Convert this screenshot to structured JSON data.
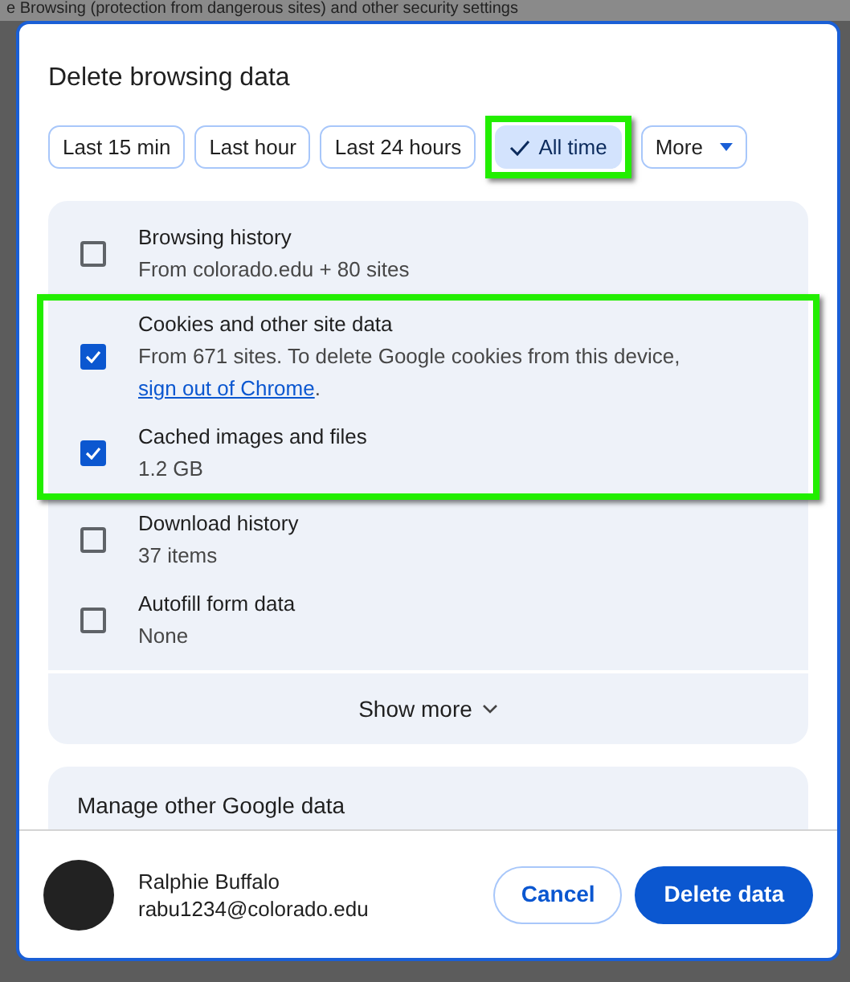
{
  "background": {
    "text": "e Browsing (protection from dangerous sites) and other security settings"
  },
  "dialog": {
    "title": "Delete browsing data"
  },
  "time_ranges": [
    {
      "label": "Last 15 min",
      "selected": false,
      "highlighted": false,
      "kind": "chip"
    },
    {
      "label": "Last hour",
      "selected": false,
      "highlighted": false,
      "kind": "chip"
    },
    {
      "label": "Last 24 hours",
      "selected": false,
      "highlighted": false,
      "kind": "chip"
    },
    {
      "label": "All time",
      "selected": true,
      "highlighted": true,
      "kind": "chip"
    },
    {
      "label": "More",
      "selected": false,
      "highlighted": false,
      "kind": "dropdown"
    }
  ],
  "items": [
    {
      "title": "Browsing history",
      "detail": "From colorado.edu + 80 sites",
      "checked": false,
      "highlighted": false
    },
    {
      "title": "Cookies and other site data",
      "detail": "From 671 sites. To delete Google cookies from this device, ",
      "link": "sign out of Chrome",
      "detail_end": ".",
      "checked": true,
      "highlighted": true
    },
    {
      "title": "Cached images and files",
      "detail": "1.2 GB",
      "checked": true,
      "highlighted": true
    },
    {
      "title": "Download history",
      "detail": "37 items",
      "checked": false,
      "highlighted": false
    },
    {
      "title": "Autofill form data",
      "detail": "None",
      "checked": false,
      "highlighted": false
    }
  ],
  "show_more": "Show more",
  "manage_panel": {
    "title": "Manage other Google data"
  },
  "account": {
    "name": "Ralphie Buffalo",
    "email": "rabu1234@colorado.edu"
  },
  "buttons": [
    {
      "label": "Cancel",
      "kind": "secondary"
    },
    {
      "label": "Delete data",
      "kind": "primary"
    }
  ]
}
